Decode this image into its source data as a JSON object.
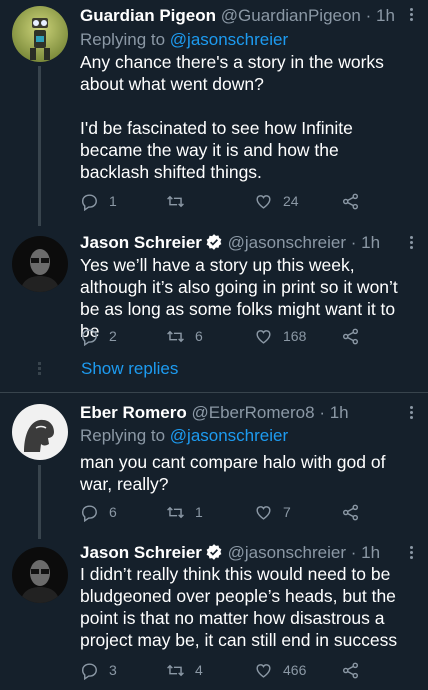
{
  "tweets": [
    {
      "name": "Guardian Pigeon",
      "handle": "@GuardianPigeon",
      "sep": "·",
      "time": "1h",
      "replying_prefix": "Replying to ",
      "replying_to": "@jasonschreier",
      "text": "Any chance there's a story in the works about what went down?\n\nI'd be fascinated to see how Infinite became the way it is and how the backlash shifted things.",
      "replies": "1",
      "retweets": "",
      "likes": "24"
    },
    {
      "name": "Jason Schreier",
      "handle": "@jasonschreier",
      "sep": "·",
      "time": "1h",
      "verified": true,
      "text": "Yes we’ll have a story up this week, although it’s also going in print so it won’t be as long as some folks might want it to be",
      "replies": "2",
      "retweets": "6",
      "likes": "168"
    },
    {
      "name": "Eber Romero",
      "handle": "@EberRomero8",
      "sep": "·",
      "time": "1h",
      "replying_prefix": "Replying to ",
      "replying_to": "@jasonschreier",
      "text": "man you cant compare halo with god of war, really?",
      "replies": "6",
      "retweets": "1",
      "likes": "7"
    },
    {
      "name": "Jason Schreier",
      "handle": "@jasonschreier",
      "sep": "·",
      "time": "1h",
      "verified": true,
      "text": "I didn’t really think this would need to be bludgeoned over people’s heads, but the point is that no matter how disastrous a project may be, it can still end in success",
      "replies": "3",
      "retweets": "4",
      "likes": "466"
    }
  ],
  "show_replies_label": "Show replies",
  "icons": [
    "more-icon",
    "reply-icon",
    "retweet-icon",
    "like-icon",
    "share-icon",
    "verified-badge-icon"
  ],
  "colors": {
    "background": "#15202b",
    "link": "#1d9bf0",
    "muted": "#8b98a5",
    "verified": "#ffffff"
  }
}
